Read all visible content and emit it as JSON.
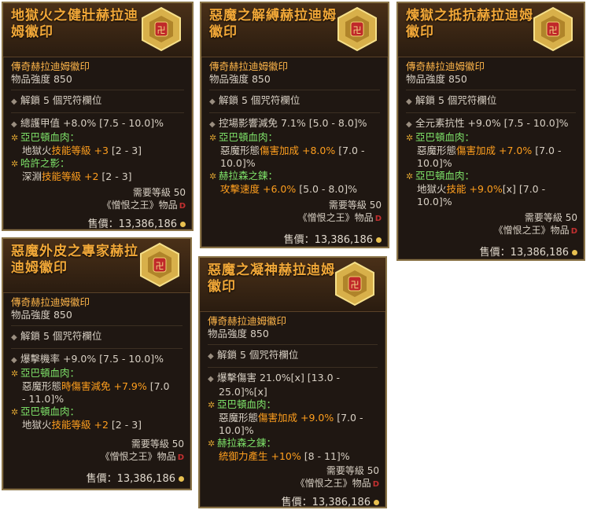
{
  "cards": [
    {
      "title": "地獄火之健壯赫拉迪姆徽印",
      "subtitle": "傳奇赫拉迪姆徽印",
      "power": "物品強度 850",
      "sockets": "解鎖 5 個咒符欄位",
      "stat": {
        "pre": "總護甲值 +8.0% [7.5 - 10.0]%"
      },
      "g1": {
        "name": "亞巴頓血肉：",
        "l1_a": "地獄火",
        "l1_b": "技能等級",
        "l1_c": " +3",
        "l1_d": " [2 - 3]"
      },
      "g2": {
        "name": "哈許之影：",
        "l1_a": "深淵",
        "l1_b": "技能等級",
        "l1_c": " +2",
        "l1_d": " [2 - 3]"
      },
      "req": "需要等級 50",
      "set": "《憎恨之王》物品",
      "price": "售價：13,386,186"
    },
    {
      "title": "惡魔之解縛赫拉迪姆徽印",
      "subtitle": "傳奇赫拉迪姆徽印",
      "power": "物品強度 850",
      "sockets": "解鎖 5 個咒符欄位",
      "stat": {
        "pre": "控場影響減免 7.1% [5.0 - 8.0]%"
      },
      "g1": {
        "name": "亞巴頓血肉：",
        "l1_a": "惡魔形態",
        "l1_b": "傷害加成",
        "l1_c": " +8.0%",
        "l1_d": " [7.0 -",
        "l2": "10.0]%"
      },
      "g2": {
        "name": "赫拉森之鍊：",
        "l1_a": "",
        "l1_b": "攻擊速度",
        "l1_c": " +6.0%",
        "l1_d": " [5.0 - 8.0]%"
      },
      "req": "需要等級 50",
      "set": "《憎恨之王》物品",
      "price": "售價：13,386,186"
    },
    {
      "title": "煉獄之抵抗赫拉迪姆徽印",
      "subtitle": "傳奇赫拉迪姆徽印",
      "power": "物品強度 850",
      "sockets": "解鎖 5 個咒符欄位",
      "stat": {
        "pre": "全元素抗性 +9.0% [7.5 - 10.0]%"
      },
      "g1": {
        "name": "亞巴頓血肉：",
        "l1_a": "惡魔形態",
        "l1_b": "傷害加成",
        "l1_c": " +7.0%",
        "l1_d": " [7.0 -",
        "l2": "10.0]%"
      },
      "g2": {
        "name": "亞巴頓血肉：",
        "l1_a": "地獄火",
        "l1_b": "技能",
        "l1_c": " +9.0%",
        "l1_d": "[x] [7.0 -",
        "l2": "10.0]%"
      },
      "req": "需要等級 50",
      "set": "《憎恨之王》物品",
      "price": "售價：13,386,186"
    },
    {
      "title": "惡魔外皮之專家赫拉迪姆徽印",
      "subtitle": "傳奇赫拉迪姆徽印",
      "power": "物品強度 850",
      "sockets": "解鎖 5 個咒符欄位",
      "stat": {
        "pre": "爆擊機率 +9.0% [7.5 - 10.0]%"
      },
      "g1": {
        "name": "亞巴頓血肉：",
        "l1_a": "惡魔形態",
        "l1_b": "時傷害減免",
        "l1_c": " +7.9%",
        "l1_d": " [7.0",
        "l2": "- 11.0]%"
      },
      "g2": {
        "name": "亞巴頓血肉：",
        "l1_a": "地獄火",
        "l1_b": "技能等級",
        "l1_c": " +2",
        "l1_d": " [2 - 3]"
      },
      "req": "需要等級 50",
      "set": "《憎恨之王》物品",
      "price": "售價：13,386,186"
    },
    {
      "title": "惡魔之凝神赫拉迪姆徽印",
      "subtitle": "傳奇赫拉迪姆徽印",
      "power": "物品強度 850",
      "sockets": "解鎖 5 個咒符欄位",
      "stat": {
        "pre": "爆擊傷害 21.0%[x] [13.0 -",
        "l2": "25.0]%[x]"
      },
      "g1": {
        "name": "亞巴頓血肉：",
        "l1_a": "惡魔形態",
        "l1_b": "傷害加成",
        "l1_c": " +9.0%",
        "l1_d": " [7.0 -",
        "l2": "10.0]%"
      },
      "g2": {
        "name": "赫拉森之鍊：",
        "l1_a": "",
        "l1_b": "統御力產生",
        "l1_c": " +10%",
        "l1_d": " [8 - 11]%"
      },
      "req": "需要等級 50",
      "set": "《憎恨之王》物品",
      "price": "售價：13,386,186"
    }
  ],
  "icons": {
    "gem": "hexagon-sigil-icon",
    "bullet": "diamond-bullet-icon",
    "legendary": "star-bullet-icon",
    "currency": "gold-coin-icon",
    "expansion": "diablo-d-icon"
  },
  "colors": {
    "title": "#f2a838",
    "affix_name": "#7fe46a",
    "highlight": "#ff9f1e",
    "body": "#d8d0c4"
  }
}
